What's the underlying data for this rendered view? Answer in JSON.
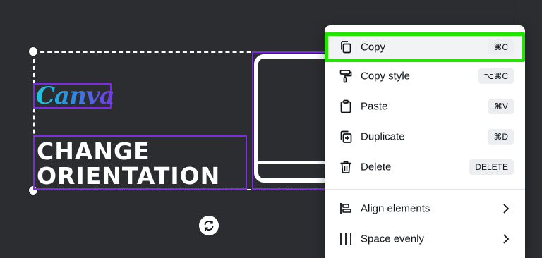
{
  "canvas": {
    "logo_text": "Canva",
    "title_line1": "CHANGE",
    "title_line2": "ORIENTATION"
  },
  "context_menu": {
    "highlight_color": "#22e400",
    "items": [
      {
        "label": "Copy",
        "shortcut": "⌘C",
        "icon": "copy-icon"
      },
      {
        "label": "Copy style",
        "shortcut": "⌥⌘C",
        "icon": "paint-roller-icon"
      },
      {
        "label": "Paste",
        "shortcut": "⌘V",
        "icon": "clipboard-icon"
      },
      {
        "label": "Duplicate",
        "shortcut": "⌘D",
        "icon": "duplicate-icon"
      },
      {
        "label": "Delete",
        "shortcut": "DELETE",
        "icon": "trash-icon"
      },
      {
        "label": "Align elements",
        "icon": "align-icon",
        "submenu": true
      },
      {
        "label": "Space evenly",
        "icon": "space-evenly-icon",
        "submenu": true
      }
    ]
  }
}
